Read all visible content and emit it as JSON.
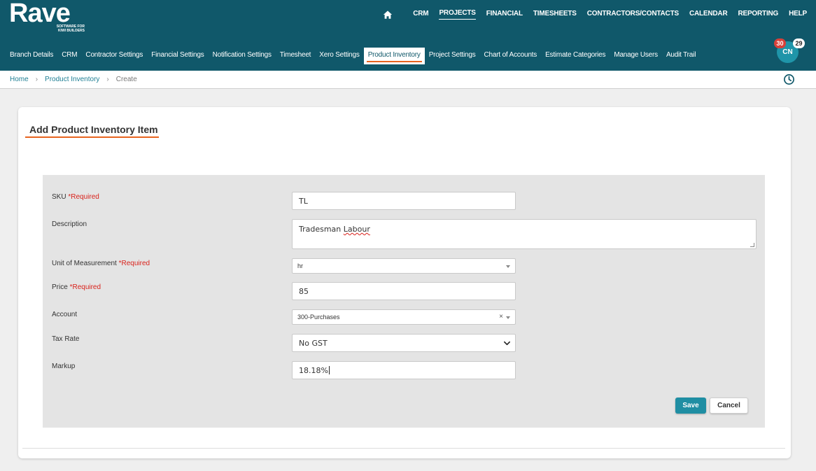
{
  "app": {
    "logo_text": "Rave",
    "logo_tagline_1": "SOFTWARE FOR",
    "logo_tagline_2": "KIWI BUILDERS"
  },
  "topnav": {
    "items": [
      "CRM",
      "PROJECTS",
      "FINANCIAL",
      "TIMESHEETS",
      "CONTRACTORS/CONTACTS",
      "CALENDAR",
      "REPORTING",
      "HELP"
    ],
    "active": "PROJECTS"
  },
  "subnav": {
    "items": [
      "Branch Details",
      "CRM",
      "Contractor Settings",
      "Financial Settings",
      "Notification Settings",
      "Timesheet",
      "Xero Settings",
      "Product Inventory",
      "Project Settings",
      "Chart of Accounts",
      "Estimate Categories",
      "Manage Users",
      "Audit Trail"
    ],
    "active": "Product Inventory"
  },
  "user": {
    "initials": "CN",
    "badge_red": "30",
    "badge_white": "29"
  },
  "breadcrumb": {
    "home": "Home",
    "section": "Product Inventory",
    "current": "Create",
    "separator": "›"
  },
  "form": {
    "title": "Add Product Inventory Item",
    "required_marker": "*Required",
    "sku": {
      "label": "SKU",
      "value": "TL"
    },
    "description": {
      "label": "Description",
      "value_prefix": "Tradesman ",
      "value_misspelled": "Labour"
    },
    "unit": {
      "label": "Unit of Measurement",
      "value": "hr"
    },
    "price": {
      "label": "Price",
      "value": "85"
    },
    "account": {
      "label": "Account",
      "value": "300-Purchases",
      "clear": "×"
    },
    "tax_rate": {
      "label": "Tax Rate",
      "value": "No GST"
    },
    "markup": {
      "label": "Markup",
      "value": "18.18%"
    },
    "save_label": "Save",
    "cancel_label": "Cancel"
  },
  "colors": {
    "header": "#10586a",
    "accent": "#e8641f",
    "primary_button": "#1f8ea3",
    "required": "#d9221b"
  }
}
